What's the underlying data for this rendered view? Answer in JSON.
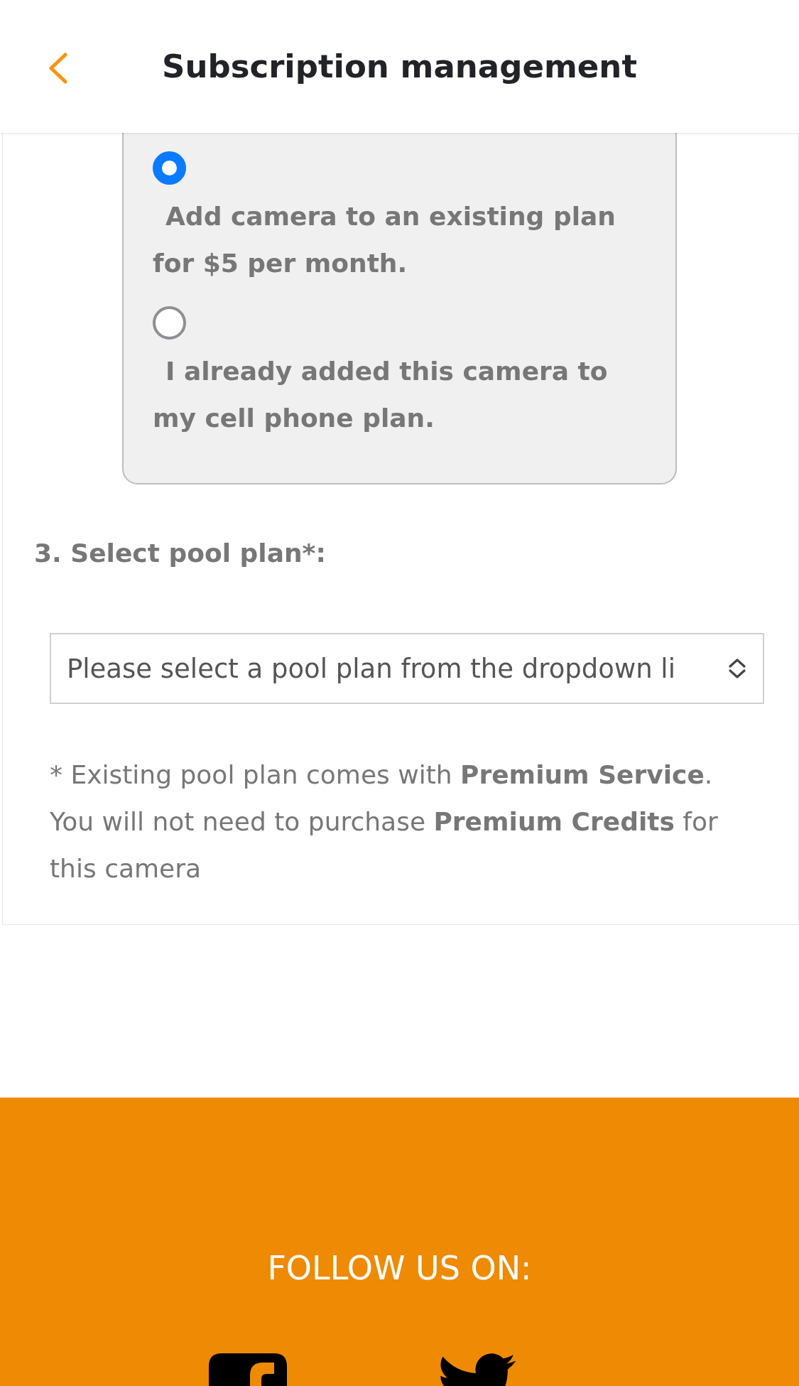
{
  "header": {
    "title": "Subscription management"
  },
  "plan_options": [
    {
      "label": "Add camera to an existing plan for $5 per month.",
      "selected": true
    },
    {
      "label": "I already added this camera to my cell phone plan.",
      "selected": false
    }
  ],
  "pool_plan": {
    "label": "3. Select pool plan*:",
    "select": {
      "value": "Please select a pool plan from the dropdown li"
    },
    "note": "* Existing pool plan comes with **Premium Service**. You will not need to purchase **Premium Credits** for this camera"
  },
  "footer": {
    "heading": "FOLLOW US ON:"
  }
}
